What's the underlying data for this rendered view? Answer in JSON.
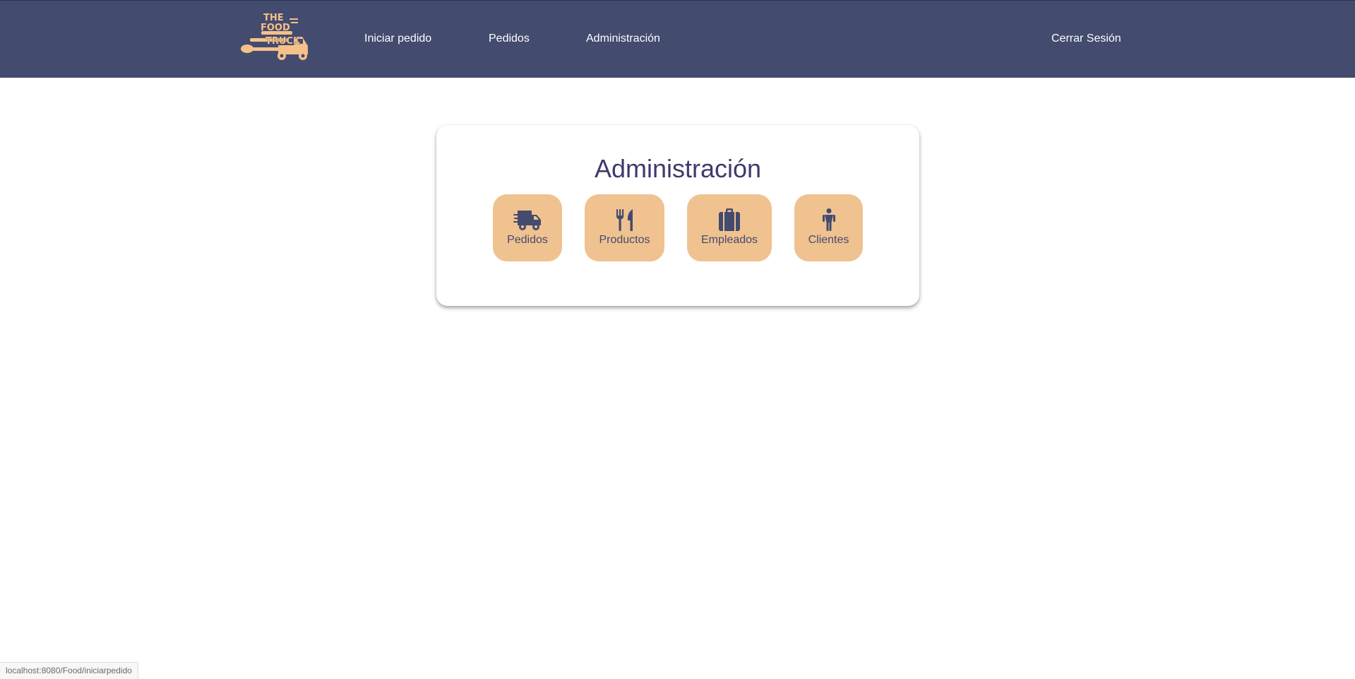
{
  "navbar": {
    "logo_text": [
      "THE",
      "FOOD",
      "TRUCK"
    ],
    "links": [
      "Iniciar pedido",
      "Pedidos",
      "Administración"
    ],
    "logout_label": "Cerrar Sesión"
  },
  "admin": {
    "title": "Administración",
    "tiles": [
      {
        "label": "Pedidos",
        "icon": "truck-fast-icon"
      },
      {
        "label": "Productos",
        "icon": "utensils-icon"
      },
      {
        "label": "Empleados",
        "icon": "suitcase-icon"
      },
      {
        "label": "Clientes",
        "icon": "person-icon"
      }
    ]
  },
  "status_bar": {
    "url": "localhost:8080/Food/iniciarpedido"
  },
  "colors": {
    "navbar_bg": "#434b6e",
    "tile_bg": "#f0c290",
    "accent_text": "#3e3a6b",
    "logo": "#f5c08a"
  }
}
